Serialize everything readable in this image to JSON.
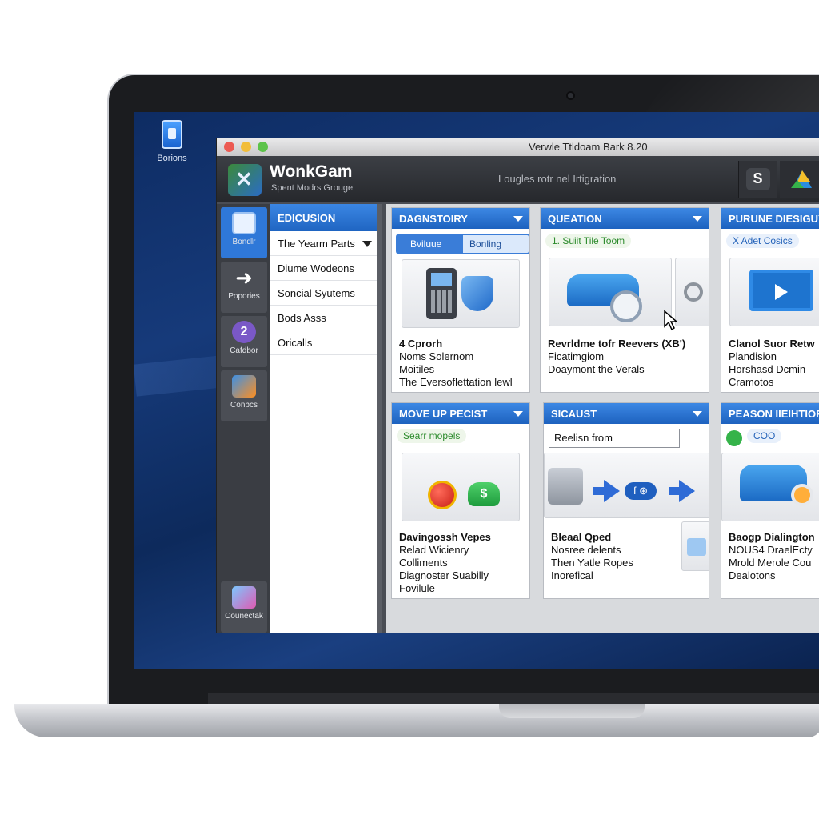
{
  "desktop": {
    "icon_label": "Borions"
  },
  "window": {
    "title": "Verwle Ttldoam Bark 8.20",
    "app_name": "WonkGam",
    "app_subtitle": "Spent Modrs Grouge",
    "header_center": "Lougles rotr nel Irtigration",
    "header_button_s": "S"
  },
  "sidebar": {
    "items": [
      {
        "label": "Bondlr",
        "icon": "document-icon"
      },
      {
        "label": "Popories",
        "icon": "arrow-icon"
      },
      {
        "label": "Cafdbor",
        "icon": "purple-circle-icon",
        "glyph": "2"
      },
      {
        "label": "Conbcs",
        "icon": "people-icon"
      }
    ],
    "bottom_item": {
      "label": "Counectak",
      "icon": "folder-icon"
    }
  },
  "panel_list": {
    "header": "EDICUSION",
    "items": [
      "The Yearm Parts",
      "Diume Wodeons",
      "Soncial Syutems",
      "Bods Asss",
      "Oricalls"
    ]
  },
  "cards": {
    "diagnostory": {
      "title": "DAGNSTOIRY",
      "seg_left": "Bviluue",
      "seg_right": "Bonling",
      "text_title": "4 Cprorh",
      "text_lines": [
        "Noms Solernom",
        "Moitiles",
        "The Eversoflettation lewl"
      ]
    },
    "queation": {
      "title": "QUEATION",
      "chip": "1. Suiit Tile Toom",
      "text_title": "Revrldme tofr Reevers (XB')",
      "text_lines": [
        "Ficatimgiom",
        "Doaymont the Verals"
      ]
    },
    "purune": {
      "title": "PURUNE DIESIGUY",
      "chip": "X Adet Cosics",
      "text_title": "Clanol Suor Retw",
      "text_lines": [
        "Plandision",
        "Horshasd Dcmin",
        "Cramotos"
      ]
    },
    "moveup": {
      "title": "MOVE UP PECIST",
      "chip": "Searr mopels",
      "text_title": "Davingossh Vepes",
      "text_lines": [
        "Relad Wicienry",
        "Colliments",
        "Diagnoster Suabilly",
        "Fovilule"
      ]
    },
    "sicaust": {
      "title": "SICAUST",
      "search_value": "Reelisn from",
      "text_title": "Bleaal Qped",
      "text_lines": [
        "Nosree delents",
        "Then Yatle Ropes",
        "Inorefical"
      ]
    },
    "peason": {
      "title": "PEASON IIEIHTIOR",
      "chip": "COO",
      "text_title": "Baogp Dialington",
      "text_lines": [
        "NOUS4 DraelEcty",
        "Mrold Merole Cou",
        "Dealotons"
      ]
    }
  },
  "colors": {
    "accent_blue": "#1f65c2",
    "header_dark": "#26282c",
    "desktop_blue": "#0e2c63"
  }
}
